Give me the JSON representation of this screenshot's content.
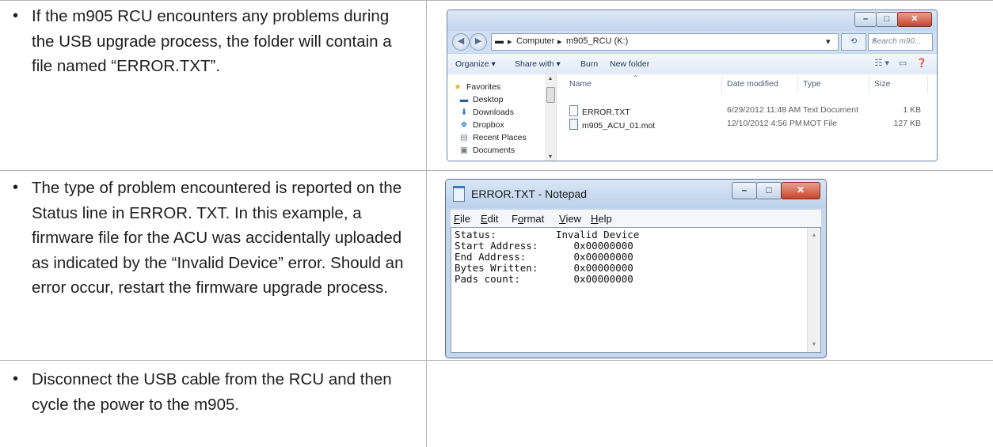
{
  "rows": [
    {
      "text": "If the m905 RCU encounters any problems during the USB upgrade process, the folder will contain a file named “ERROR.TXT”."
    },
    {
      "text": "The type of problem encountered is reported on the Status line in ERROR. TXT.  In this example, a firmware file for the ACU was accidentally uploaded as indicated by the “Invalid Device” error.  Should an error occur, restart the firmware upgrade process."
    },
    {
      "text": "Disconnect the USB cable from the RCU and then cycle the power to the m905."
    }
  ],
  "explorer": {
    "breadcrumb": [
      "Computer",
      "m905_RCU (K:)"
    ],
    "search_placeholder": "Search m90...",
    "toolbar": {
      "organize": "Organize ▾",
      "share_with": "Share with ▾",
      "burn": "Burn",
      "new_folder": "New folder"
    },
    "nav": [
      "Favorites",
      "Desktop",
      "Downloads",
      "Dropbox",
      "Recent Places",
      "Documents"
    ],
    "columns": {
      "name": "Name",
      "date": "Date modified",
      "type": "Type",
      "size": "Size"
    },
    "files": [
      {
        "name": "ERROR.TXT",
        "date": "6/29/2012 11:48 AM",
        "type": "Text Document",
        "size": "1 KB"
      },
      {
        "name": "m905_ACU_01.mot",
        "date": "12/10/2012 4:56 PM",
        "type": "MOT File",
        "size": "127 KB"
      }
    ]
  },
  "notepad": {
    "title": "ERROR.TXT - Notepad",
    "menu": {
      "file": "ile",
      "edit": "dit",
      "format_pre": "F",
      "format_ul": "o",
      "format_post": "rmat",
      "view": "iew",
      "help": "elp"
    },
    "lines": [
      "Status:          Invalid Device",
      "Start Address:      0x00000000",
      "End Address:        0x00000000",
      "Bytes Written:      0x00000000",
      "Pads count:         0x00000000"
    ]
  },
  "colors": {
    "rule": "#b5b5b5",
    "win_frame": "#6b88a8",
    "close_red": "#c8452d"
  }
}
